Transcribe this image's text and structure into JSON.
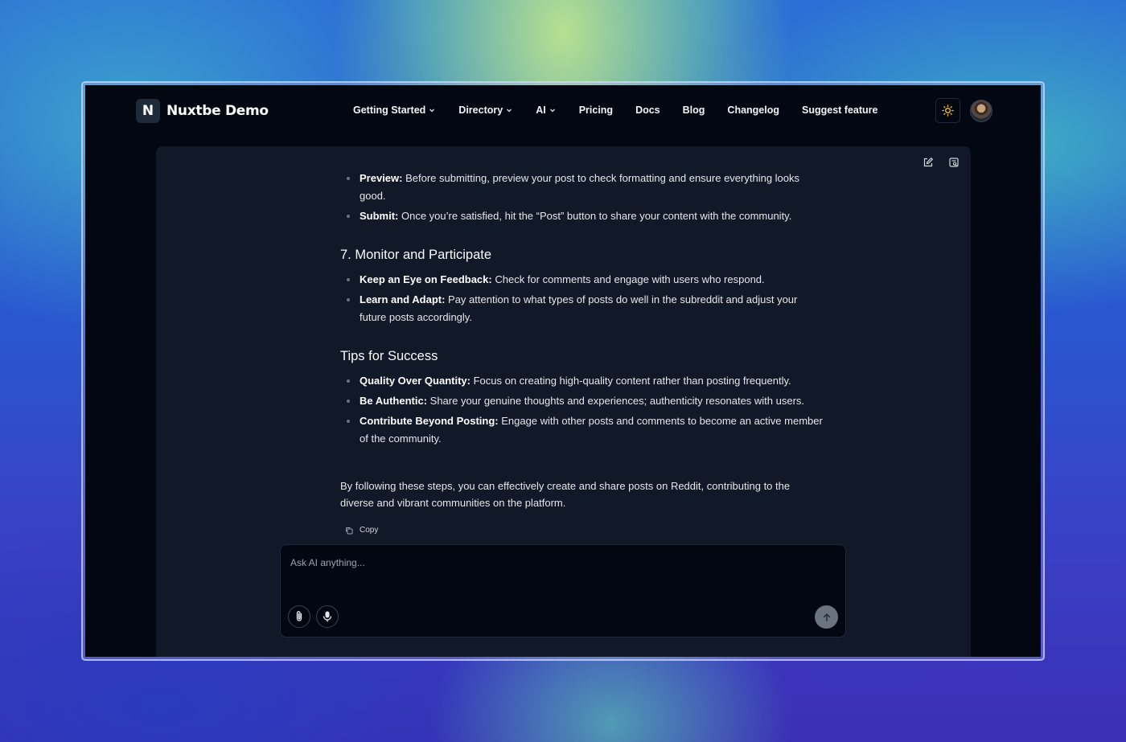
{
  "brand": {
    "logo_letter": "N",
    "name": "Nuxtbe Demo"
  },
  "nav": {
    "items": [
      {
        "label": "Getting Started",
        "dropdown": true
      },
      {
        "label": "Directory",
        "dropdown": true
      },
      {
        "label": "AI",
        "dropdown": true
      },
      {
        "label": "Pricing",
        "dropdown": false
      },
      {
        "label": "Docs",
        "dropdown": false
      },
      {
        "label": "Blog",
        "dropdown": false
      },
      {
        "label": "Changelog",
        "dropdown": false
      },
      {
        "label": "Suggest feature",
        "dropdown": false
      }
    ]
  },
  "header_icons": [
    "sun-icon",
    "avatar"
  ],
  "panel_icons": [
    "edit-icon",
    "history-icon"
  ],
  "message": {
    "section_top": [
      {
        "bold": "Preview:",
        "text": " Before submitting, preview your post to check formatting and ensure everything looks good."
      },
      {
        "bold": "Submit:",
        "text": " Once you’re satisfied, hit the “Post” button to share your content with the community."
      }
    ],
    "heading_monitor": "7. Monitor and Participate",
    "section_monitor": [
      {
        "bold": "Keep an Eye on Feedback:",
        "text": " Check for comments and engage with users who respond."
      },
      {
        "bold": "Learn and Adapt:",
        "text": " Pay attention to what types of posts do well in the subreddit and adjust your future posts accordingly."
      }
    ],
    "heading_tips": "Tips for Success",
    "section_tips": [
      {
        "bold": "Quality Over Quantity:",
        "text": " Focus on creating high-quality content rather than posting frequently."
      },
      {
        "bold": "Be Authentic:",
        "text": " Share your genuine thoughts and experiences; authenticity resonates with users."
      },
      {
        "bold": "Contribute Beyond Posting:",
        "text": " Engage with other posts and comments to become an active member of the community."
      }
    ],
    "closing": "By following these steps, you can effectively create and share posts on Reddit, contributing to the diverse and vibrant communities on the platform."
  },
  "copy_label": "Copy",
  "composer": {
    "placeholder": "Ask AI anything..."
  },
  "colors": {
    "app_bg": "#030712",
    "panel_bg": "#111827",
    "send_button": "#6b7280"
  }
}
